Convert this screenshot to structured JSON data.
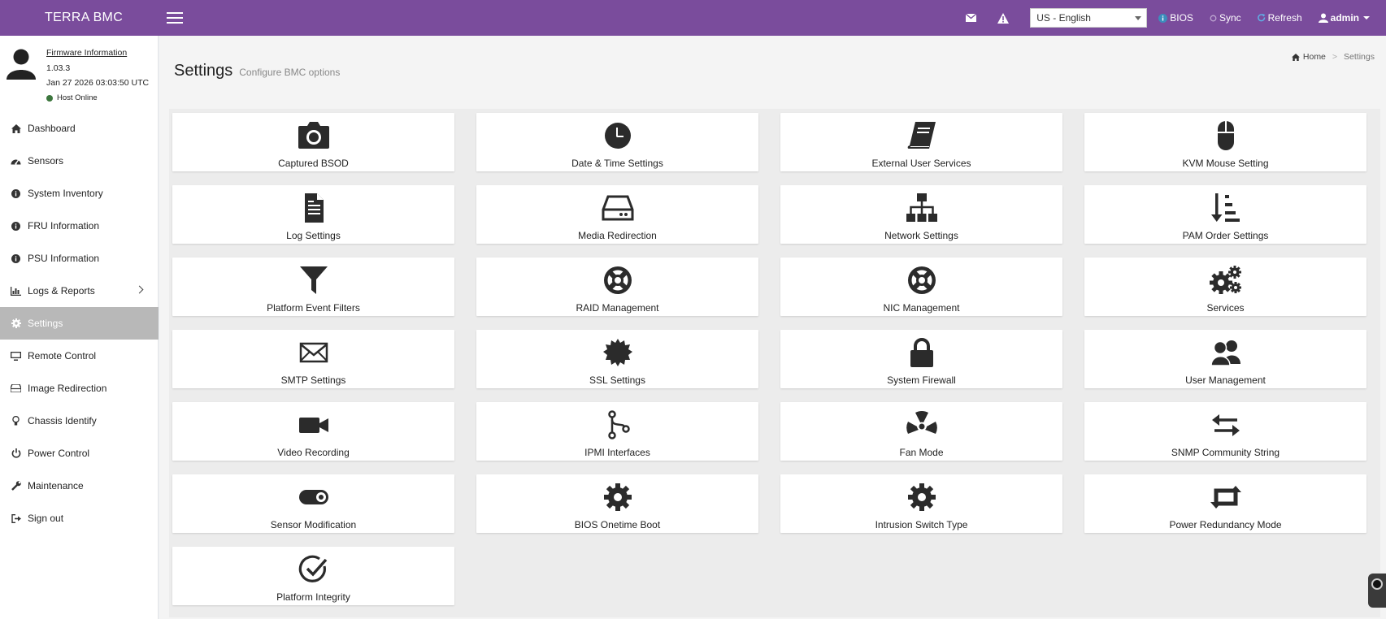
{
  "header": {
    "brand": "TERRA BMC",
    "language": "US - English",
    "bios": "BIOS",
    "sync": "Sync",
    "refresh": "Refresh",
    "user": "admin"
  },
  "user_panel": {
    "fw_link": "Firmware Information",
    "version": "1.03.3",
    "datetime": "Jan 27 2026 03:03:50 UTC",
    "host_status": "Host Online"
  },
  "menu": [
    {
      "label": "Dashboard",
      "icon": "home-icon"
    },
    {
      "label": "Sensors",
      "icon": "gauge-icon"
    },
    {
      "label": "System Inventory",
      "icon": "info-icon"
    },
    {
      "label": "FRU Information",
      "icon": "info-icon"
    },
    {
      "label": "PSU Information",
      "icon": "info-icon"
    },
    {
      "label": "Logs & Reports",
      "icon": "bar-chart-icon"
    },
    {
      "label": "Settings",
      "icon": "gear-icon"
    },
    {
      "label": "Remote Control",
      "icon": "monitor-icon"
    },
    {
      "label": "Image Redirection",
      "icon": "drive-icon"
    },
    {
      "label": "Chassis Identify",
      "icon": "lightbulb-icon"
    },
    {
      "label": "Power Control",
      "icon": "power-icon"
    },
    {
      "label": "Maintenance",
      "icon": "wrench-icon"
    },
    {
      "label": "Sign out",
      "icon": "sign-out-icon"
    }
  ],
  "active_menu": "Settings",
  "page": {
    "title": "Settings",
    "subtitle": "Configure BMC options",
    "breadcrumb_home": "Home",
    "breadcrumb_current": "Settings"
  },
  "tiles": [
    {
      "label": "Captured BSOD",
      "icon": "camera-icon"
    },
    {
      "label": "Date & Time Settings",
      "icon": "clock-icon"
    },
    {
      "label": "External User Services",
      "icon": "book-icon"
    },
    {
      "label": "KVM Mouse Setting",
      "icon": "mouse-icon"
    },
    {
      "label": "Log Settings",
      "icon": "document-icon"
    },
    {
      "label": "Media Redirection",
      "icon": "hard-drive-icon"
    },
    {
      "label": "Network Settings",
      "icon": "sitemap-icon"
    },
    {
      "label": "PAM Order Settings",
      "icon": "sort-order-icon"
    },
    {
      "label": "Platform Event Filters",
      "icon": "filter-icon"
    },
    {
      "label": "RAID Management",
      "icon": "lifebuoy-icon"
    },
    {
      "label": "NIC Management",
      "icon": "lifebuoy-icon"
    },
    {
      "label": "Services",
      "icon": "gears-icon"
    },
    {
      "label": "SMTP Settings",
      "icon": "envelope-icon"
    },
    {
      "label": "SSL Settings",
      "icon": "certificate-icon"
    },
    {
      "label": "System Firewall",
      "icon": "lock-icon"
    },
    {
      "label": "User Management",
      "icon": "users-icon"
    },
    {
      "label": "Video Recording",
      "icon": "video-camera-icon"
    },
    {
      "label": "IPMI Interfaces",
      "icon": "branch-icon"
    },
    {
      "label": "Fan Mode",
      "icon": "radiation-icon"
    },
    {
      "label": "SNMP Community String",
      "icon": "exchange-icon"
    },
    {
      "label": "Sensor Modification",
      "icon": "toggle-icon"
    },
    {
      "label": "BIOS Onetime Boot",
      "icon": "gear-icon"
    },
    {
      "label": "Intrusion Switch Type",
      "icon": "gear-icon"
    },
    {
      "label": "Power Redundancy Mode",
      "icon": "retweet-icon"
    },
    {
      "label": "Platform Integrity",
      "icon": "check-circle-icon"
    }
  ],
  "colors": {
    "header_bg": "#7a4c9c",
    "active_menu_bg": "#b8b8b8",
    "host_online": "#3c763d",
    "info_blue": "#3c8dbc",
    "icon_dark": "#2b2b2b"
  }
}
